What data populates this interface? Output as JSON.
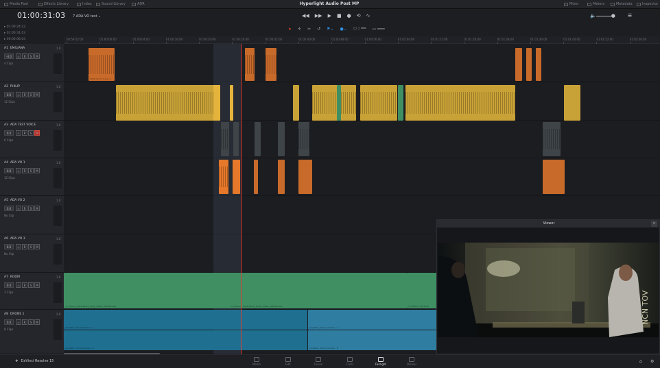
{
  "topbar": {
    "left": [
      "Media Pool",
      "Effects Library",
      "Index",
      "Sound Library",
      "ADR"
    ],
    "right": [
      "Mixer",
      "Meters",
      "Metadata",
      "Inspector"
    ],
    "project_title": "Hyperlight Audio Post MP"
  },
  "header": {
    "timecode": "01:00:31:03",
    "track_selector": "7 ADA VO test",
    "small_timecodes": [
      "01:00:24:22",
      "01:00:31:03",
      "00:00:06:04"
    ],
    "transport_icons": [
      "rewind-icon",
      "fast-forward-icon",
      "play-icon",
      "stop-icon",
      "record-icon",
      "loop-icon"
    ],
    "tool_icons": [
      "pointer-icon",
      "range-icon",
      "razor-icon",
      "snap-icon",
      "flag-icon",
      "marker-icon",
      "zoom-icon"
    ]
  },
  "ruler": {
    "ticks": [
      "00:59:52:00",
      "01:00:00:00",
      "01:00:04:00",
      "01:00:16:00",
      "01:00:20:00",
      "01:00:24:00",
      "01:00:32:00",
      "01:00:40:00",
      "01:00:48:00",
      "01:00:56:00",
      "01:01:04:00",
      "01:01:12:00",
      "01:01:20:00",
      "01:01:28:00",
      "01:01:36:00",
      "01:01:44:00",
      "01:01:52:00",
      "01:02:00:00"
    ]
  },
  "tracks": [
    {
      "id": "A1",
      "name": "EMILIANA",
      "vol": "-4.0",
      "clips": "4 Clips",
      "channels": "1.0"
    },
    {
      "id": "A2",
      "name": "PHILIP",
      "vol": "0.0",
      "clips": "12 Clips",
      "channels": "1.0"
    },
    {
      "id": "A3",
      "name": "ADA TEST VOICE",
      "vol": "0.0",
      "clips": "6 Clips",
      "channels": "1.0"
    },
    {
      "id": "A4",
      "name": "ADA VO 1",
      "vol": "0.0",
      "clips": "12 Clips",
      "channels": "1.0"
    },
    {
      "id": "A5",
      "name": "ADA VO 2",
      "vol": "0.0",
      "clips": "No Clip",
      "channels": "1.0"
    },
    {
      "id": "A6",
      "name": "ADA VO 3",
      "vol": "0.0",
      "clips": "No Clip",
      "channels": "1.0"
    },
    {
      "id": "A7",
      "name": "ROOM",
      "vol": "0.0",
      "clips": "3 Clips",
      "channels": "1.0"
    },
    {
      "id": "A8",
      "name": "DRONE 1",
      "vol": "0.0",
      "clips": "8 Clips",
      "channels": "2.0"
    }
  ],
  "track_buttons": [
    "R",
    "S",
    "M"
  ],
  "clip_labels": {
    "a1": "1608_01_Fr_1.wav_1",
    "room1": "Yt_Interior_2018-06-12_1001_70003_100002.wav",
    "room2": "Yt_Interior_2018-06-12_1001_70003_100002.wav",
    "room3": "Yt_Interior_2018-06",
    "drone1": "propeller_drone_full.wav - L",
    "drone2": "propeller_drone_full.wav - R",
    "drone3": "propeller_drone_full.wav - L",
    "drone4": "propeller_drone_full.wav - R"
  },
  "viewer": {
    "title": "Viewer",
    "overlay_text": "NCN TOV"
  },
  "bottom": {
    "app_name": "DaVinci Resolve 15",
    "pages": [
      "Media",
      "Edit",
      "Fusion",
      "Color",
      "Fairlight",
      "Deliver"
    ],
    "active_page": "Fairlight"
  }
}
